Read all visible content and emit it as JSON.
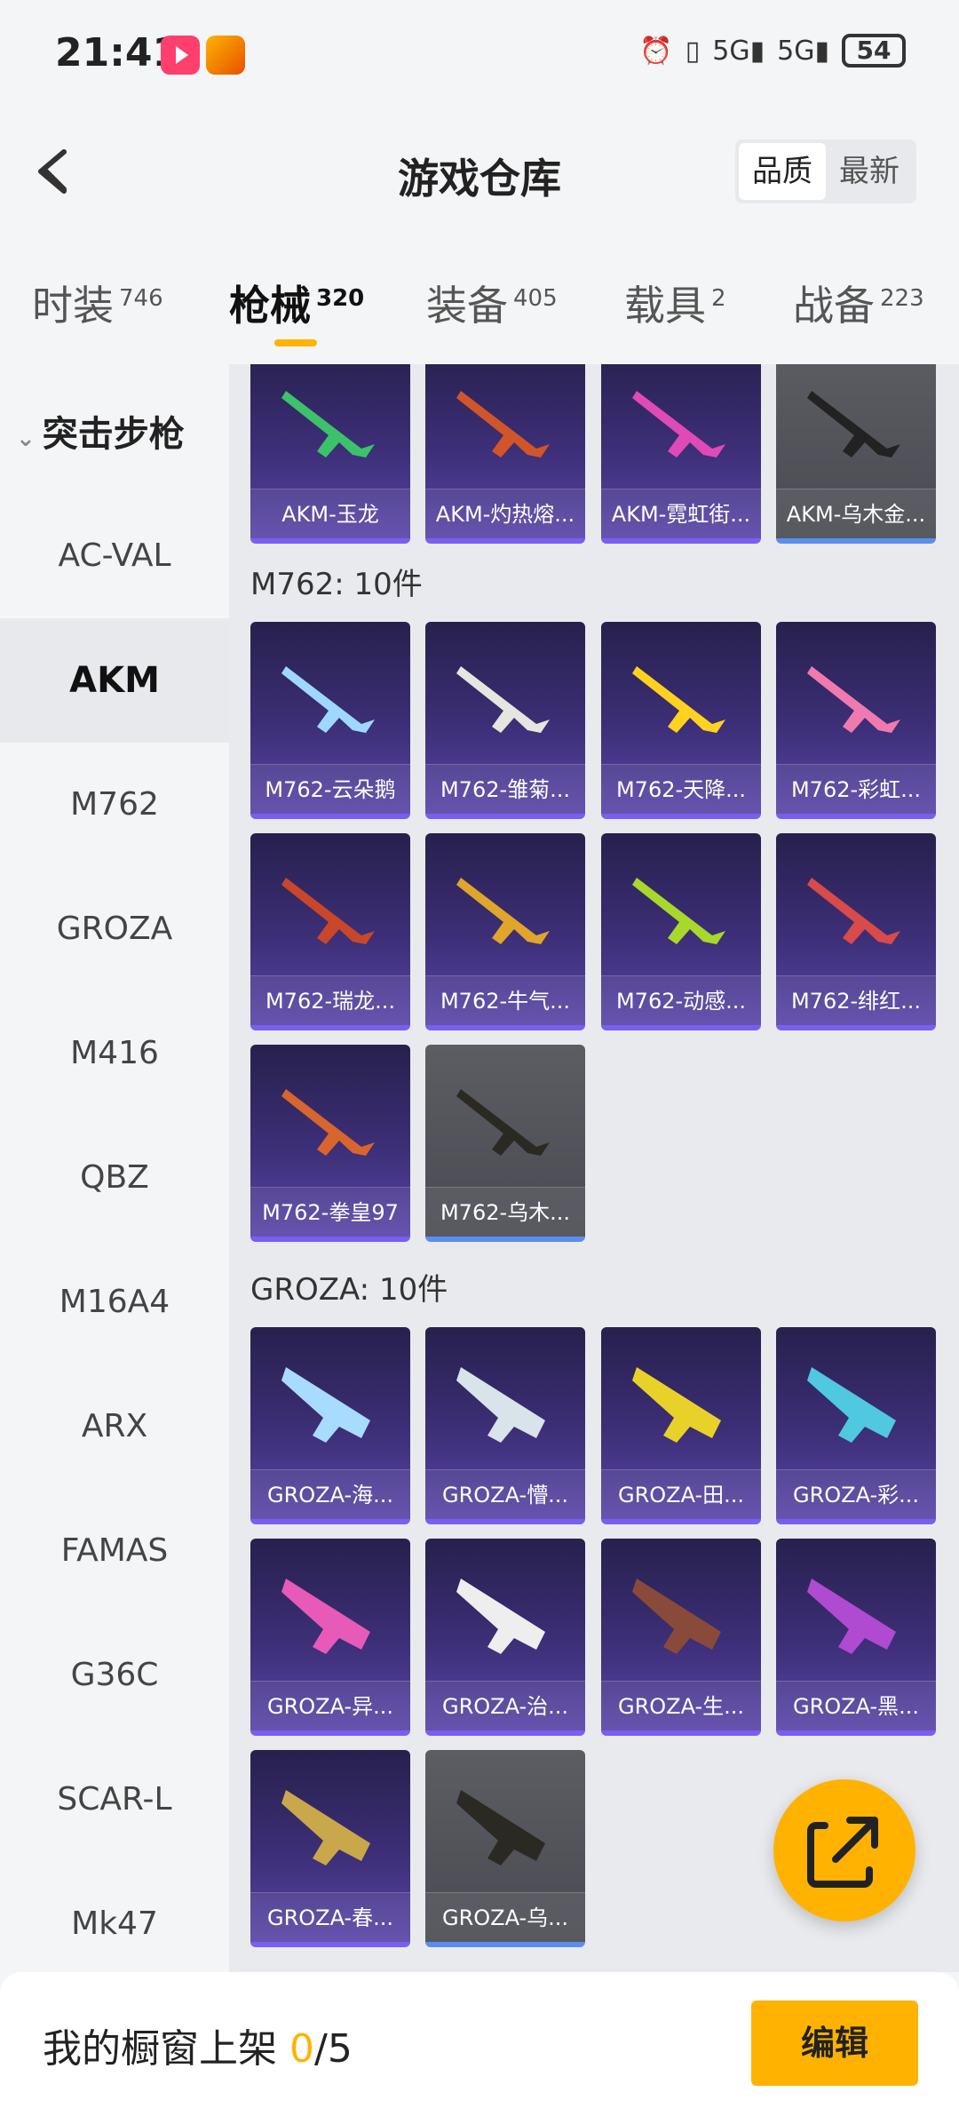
{
  "status_bar": {
    "time": "21:41",
    "network": "5G",
    "battery": "54"
  },
  "header": {
    "title": "游戏仓库",
    "sort_quality": "品质",
    "sort_newest": "最新"
  },
  "tabs": [
    {
      "label": "时装",
      "count": "746"
    },
    {
      "label": "枪械",
      "count": "320"
    },
    {
      "label": "装备",
      "count": "405"
    },
    {
      "label": "载具",
      "count": "2"
    },
    {
      "label": "战备",
      "count": "223"
    }
  ],
  "sidebar": {
    "category": "突击步枪",
    "items": [
      "AC-VAL",
      "AKM",
      "M762",
      "GROZA",
      "M416",
      "QBZ",
      "M16A4",
      "ARX",
      "FAMAS",
      "G36C",
      "SCAR-L",
      "Mk47"
    ]
  },
  "akm_items": [
    "AKM-玉龙",
    "AKM-灼热熔...",
    "AKM-霓虹街...",
    "AKM-乌木金..."
  ],
  "m762": {
    "title": "M762: 10件",
    "items": [
      "M762-云朵鹅",
      "M762-雏菊...",
      "M762-天降...",
      "M762-彩虹...",
      "M762-瑞龙...",
      "M762-牛气...",
      "M762-动感...",
      "M762-绯红...",
      "M762-拳皇97",
      "M762-乌木..."
    ]
  },
  "groza": {
    "title": "GROZA: 10件",
    "items": [
      "GROZA-海...",
      "GROZA-懵...",
      "GROZA-田...",
      "GROZA-彩...",
      "GROZA-异...",
      "GROZA-治...",
      "GROZA-生...",
      "GROZA-黑...",
      "GROZA-春...",
      "GROZA-乌..."
    ]
  },
  "bottom": {
    "label": "我的橱窗上架",
    "current": "0",
    "total": "/5",
    "edit": "编辑"
  },
  "colors": {
    "accent": "#ffb300",
    "card_purple": "#3d2f78",
    "card_gray": "#4a4b52"
  }
}
